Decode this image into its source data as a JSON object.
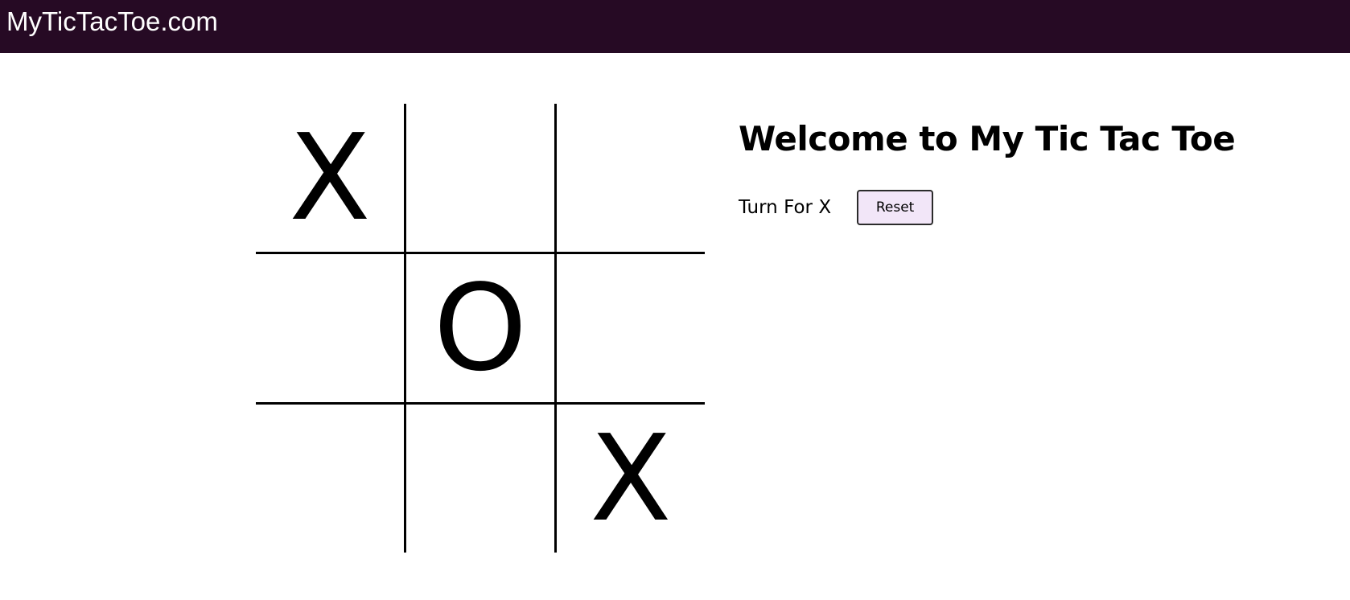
{
  "navbar": {
    "brand": "MyTicTacToe.com",
    "background": "#260a24"
  },
  "board": {
    "cells": [
      "X",
      "",
      "",
      "",
      "O",
      "",
      "",
      "",
      "X"
    ]
  },
  "info": {
    "heading": "Welcome to My Tic Tac Toe",
    "turn_text": "Turn For X",
    "reset_label": "Reset",
    "reset_background": "#f2e6f8"
  }
}
